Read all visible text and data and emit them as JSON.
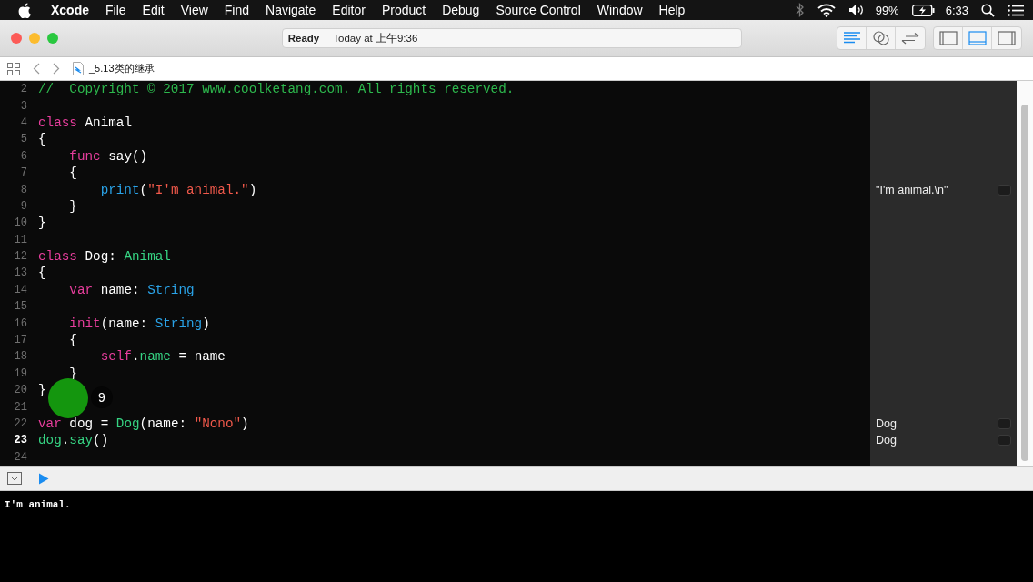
{
  "menu_bar": {
    "app": "Xcode",
    "items": [
      "File",
      "Edit",
      "View",
      "Find",
      "Navigate",
      "Editor",
      "Product",
      "Debug",
      "Source Control",
      "Window",
      "Help"
    ],
    "battery": "99%",
    "time": "6:33"
  },
  "toolbar": {
    "status": "Ready",
    "activity": "Today at 上午9:36",
    "editor_modes": [
      {
        "selected": true
      },
      {
        "selected": false
      },
      {
        "selected": false
      }
    ],
    "panels": [
      {
        "on": false
      },
      {
        "on": true
      },
      {
        "on": false
      }
    ]
  },
  "jump_bar": {
    "file": "_5.13类的继承"
  },
  "editor": {
    "lines": [
      {
        "n": "2",
        "current": false,
        "tokens": [
          {
            "t": "//  Copyright © 2017 www.coolketang.com. All rights reserved.",
            "kind": "comment"
          }
        ]
      },
      {
        "n": "3",
        "current": false
      },
      {
        "n": "4",
        "current": false,
        "tokens": [
          {
            "t": "class",
            "kind": "keyword"
          },
          {
            "t": " Animal",
            "kind": "plain"
          }
        ]
      },
      {
        "n": "5",
        "current": false,
        "tokens": [
          {
            "t": "{",
            "kind": "plain"
          }
        ]
      },
      {
        "n": "6",
        "current": false,
        "tokens": [
          {
            "t": "    func",
            "kind": "keyword"
          },
          {
            "t": " say()",
            "kind": "plain"
          }
        ]
      },
      {
        "n": "7",
        "current": false,
        "tokens": [
          {
            "t": "    {",
            "kind": "plain"
          }
        ]
      },
      {
        "n": "8",
        "current": false,
        "tokens": [
          {
            "t": "        print",
            "kind": "type"
          },
          {
            "t": "(",
            "kind": "plain"
          },
          {
            "t": "\"I'm animal.\"",
            "kind": "string"
          },
          {
            "t": ")",
            "kind": "plain"
          }
        ],
        "result": "\"I'm animal.\\n\""
      },
      {
        "n": "9",
        "current": false,
        "tokens": [
          {
            "t": "    }",
            "kind": "plain"
          }
        ]
      },
      {
        "n": "10",
        "current": false,
        "tokens": [
          {
            "t": "}",
            "kind": "plain"
          }
        ]
      },
      {
        "n": "11",
        "current": false
      },
      {
        "n": "12",
        "current": false,
        "tokens": [
          {
            "t": "class",
            "kind": "keyword"
          },
          {
            "t": " Dog: ",
            "kind": "plain"
          },
          {
            "t": "Animal",
            "kind": "project"
          }
        ]
      },
      {
        "n": "13",
        "current": false,
        "tokens": [
          {
            "t": "{",
            "kind": "plain"
          }
        ]
      },
      {
        "n": "14",
        "current": false,
        "tokens": [
          {
            "t": "    var",
            "kind": "keyword"
          },
          {
            "t": " name: ",
            "kind": "plain"
          },
          {
            "t": "String",
            "kind": "type"
          }
        ]
      },
      {
        "n": "15",
        "current": false
      },
      {
        "n": "16",
        "current": false,
        "tokens": [
          {
            "t": "    init",
            "kind": "keyword"
          },
          {
            "t": "(name: ",
            "kind": "plain"
          },
          {
            "t": "String",
            "kind": "type"
          },
          {
            "t": ")",
            "kind": "plain"
          }
        ]
      },
      {
        "n": "17",
        "current": false,
        "tokens": [
          {
            "t": "    {",
            "kind": "plain"
          }
        ]
      },
      {
        "n": "18",
        "current": false,
        "tokens": [
          {
            "t": "        self",
            "kind": "keyword"
          },
          {
            "t": ".",
            "kind": "plain"
          },
          {
            "t": "name",
            "kind": "project"
          },
          {
            "t": " = name",
            "kind": "plain"
          }
        ]
      },
      {
        "n": "19",
        "current": false,
        "tokens": [
          {
            "t": "    }",
            "kind": "plain"
          }
        ]
      },
      {
        "n": "20",
        "current": false,
        "tokens": [
          {
            "t": "}",
            "kind": "plain"
          }
        ]
      },
      {
        "n": "21",
        "current": false
      },
      {
        "n": "22",
        "current": false,
        "tokens": [
          {
            "t": "var",
            "kind": "keyword"
          },
          {
            "t": " dog = ",
            "kind": "plain"
          },
          {
            "t": "Dog",
            "kind": "project"
          },
          {
            "t": "(name: ",
            "kind": "plain"
          },
          {
            "t": "\"Nono\"",
            "kind": "string"
          },
          {
            "t": ")",
            "kind": "plain"
          }
        ],
        "result": "Dog"
      },
      {
        "n": "23",
        "current": true,
        "tokens": [
          {
            "t": "dog",
            "kind": "project"
          },
          {
            "t": ".",
            "kind": "plain"
          },
          {
            "t": "say",
            "kind": "project"
          },
          {
            "t": "()",
            "kind": "plain"
          }
        ],
        "result": "Dog"
      },
      {
        "n": "24",
        "current": false
      }
    ]
  },
  "click_indicator": {
    "label": "9"
  },
  "console": {
    "output": "I'm animal."
  }
}
